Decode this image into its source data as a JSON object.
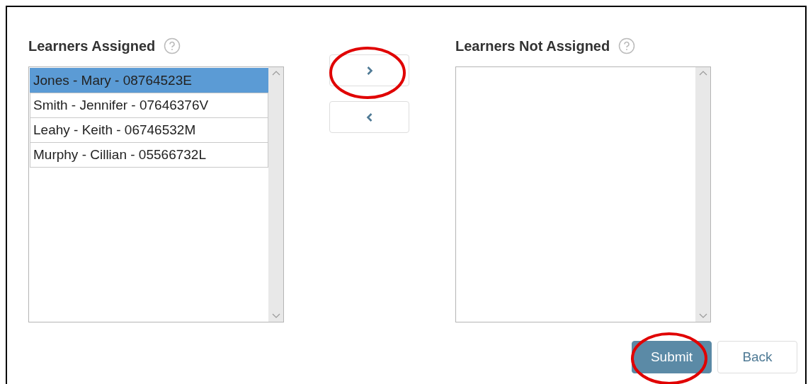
{
  "assigned": {
    "label": "Learners Assigned",
    "items": [
      {
        "text": "Jones - Mary - 08764523E",
        "selected": true
      },
      {
        "text": "Smith - Jennifer - 07646376V",
        "selected": false
      },
      {
        "text": "Leahy - Keith - 06746532M",
        "selected": false
      },
      {
        "text": "Murphy - Cillian - 05566732L",
        "selected": false
      }
    ]
  },
  "move_buttons": [
    {
      "kind": "right",
      "highlighted": true
    },
    {
      "kind": "left",
      "highlighted": false
    }
  ],
  "not_assigned": {
    "label": "Learners Not Assigned"
  },
  "actions": [
    {
      "label": "Submit",
      "kind": "primary",
      "highlighted": true
    },
    {
      "label": "Back",
      "kind": "secondary",
      "highlighted": false
    }
  ]
}
